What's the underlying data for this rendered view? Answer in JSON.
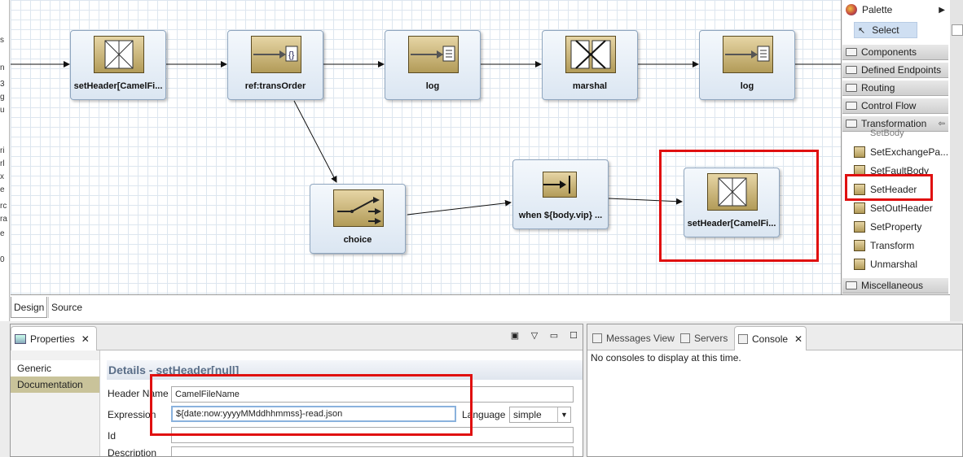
{
  "left_strip": {
    "fragments": [
      "s",
      "n",
      "3",
      "g",
      "u",
      "ri",
      "rl",
      "x",
      "e",
      "rc",
      "ra",
      "e",
      "0"
    ]
  },
  "canvas": {
    "nodes": [
      {
        "id": "setheader-1",
        "label": "setHeader[CamelFi...",
        "icon": "header-transform-icon"
      },
      {
        "id": "ref-transorder",
        "label": "ref:transOrder",
        "icon": "processor-ref-icon"
      },
      {
        "id": "log-1",
        "label": "log",
        "icon": "log-icon"
      },
      {
        "id": "marshal",
        "label": "marshal",
        "icon": "marshal-icon"
      },
      {
        "id": "log-2",
        "label": "log",
        "icon": "log-icon"
      },
      {
        "id": "choice",
        "label": "choice",
        "icon": "choice-switch-icon"
      },
      {
        "id": "when",
        "label": "when ${body.vip} ...",
        "icon": "when-arrow-icon"
      },
      {
        "id": "setheader-2",
        "label": "setHeader[CamelFi...",
        "icon": "header-transform-icon"
      }
    ]
  },
  "palette": {
    "title": "Palette",
    "select_label": "Select",
    "drawers": {
      "components": "Components",
      "defined_endpoints": "Defined Endpoints",
      "routing": "Routing",
      "control_flow": "Control Flow",
      "transformation": "Transformation",
      "miscellaneous": "Miscellaneous"
    },
    "partial_item": "SetBody",
    "items": [
      "SetExchangePa...",
      "SetFaultBody",
      "SetHeader",
      "SetOutHeader",
      "SetProperty",
      "Transform",
      "Unmarshal"
    ]
  },
  "editor_tabs": {
    "design": "Design",
    "source": "Source"
  },
  "properties": {
    "tab_label": "Properties",
    "side_tabs": {
      "generic": "Generic",
      "documentation": "Documentation"
    },
    "details_title": "Details - setHeader[null]",
    "fields": {
      "header_name_label": "Header Name",
      "header_name_value": "CamelFileName",
      "expression_label": "Expression",
      "expression_value": "${date:now:yyyyMMddhhmmss}-read.json",
      "language_label": "Language",
      "language_value": "simple",
      "id_label": "Id",
      "id_value": "",
      "description_label": "Description",
      "description_value": ""
    }
  },
  "console": {
    "tabs": {
      "messages": "Messages View",
      "servers": "Servers",
      "console": "Console"
    },
    "message": "No consoles to display at this time."
  },
  "colors": {
    "highlight": "#e01010",
    "node_icon": "#b29b58",
    "selected_tab": "#c9c39a"
  }
}
